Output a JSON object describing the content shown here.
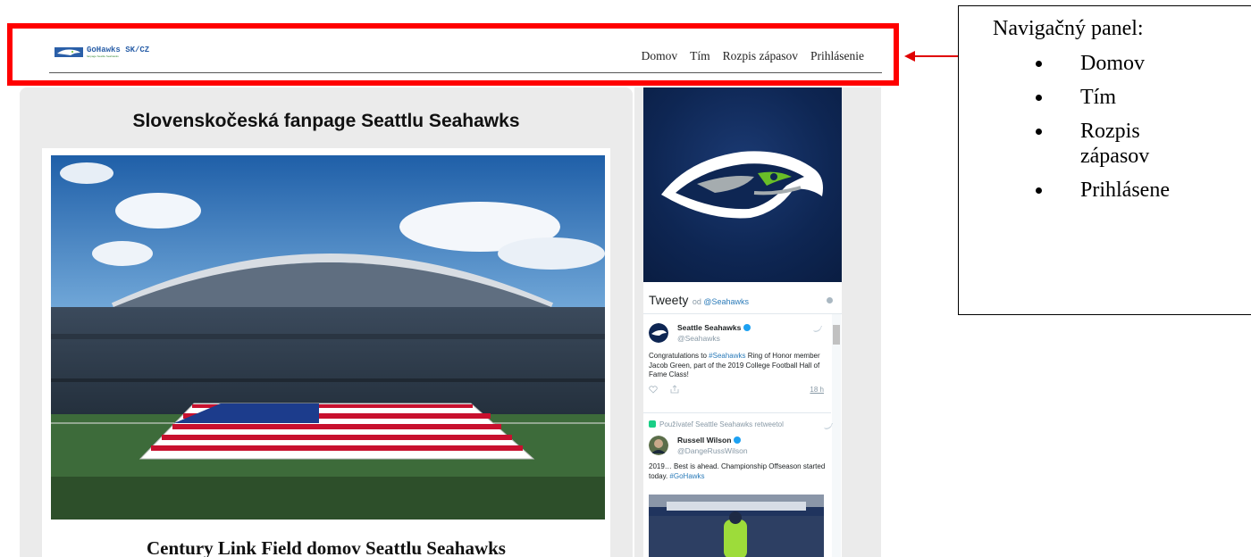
{
  "site": {
    "logo_text": "GoHawks SK/CZ",
    "logo_tagline": "fanpage Seattle Seahawks"
  },
  "nav": {
    "items": [
      {
        "label": "Domov"
      },
      {
        "label": "Tím"
      },
      {
        "label": "Rozpis zápasov"
      },
      {
        "label": "Prihlásenie"
      }
    ]
  },
  "annotation": {
    "title": "Navigačný panel:",
    "items": [
      "Domov",
      "Tím",
      "Rozpis zápasov",
      "Prihlásene"
    ]
  },
  "main": {
    "title": "Slovenskočeská fanpage Seattlu Seahawks",
    "caption": "Century Link Field domov Seattlu Seahawks"
  },
  "twitter": {
    "header_title": "Tweety",
    "header_by": "od",
    "header_handle": "@Seahawks",
    "tweet1": {
      "name": "Seattle Seahawks",
      "handle": "@Seahawks",
      "text_before": "Congratulations to ",
      "text_link": "#Seahawks",
      "text_after": " Ring of Honor member Jacob Green, part of the 2019 College Football Hall of Fame Class!",
      "time": "18 h"
    },
    "retweet_label": "Používateľ Seattle Seahawks retweetol",
    "tweet2": {
      "name": "Russell Wilson",
      "handle": "@DangeRussWilson",
      "text_before": "2019… Best is ahead. Championship Offseason started today. ",
      "text_link": "#GoHawks"
    }
  },
  "colors": {
    "highlight": "#ff0000",
    "arrow": "#e00000",
    "seahawks_navy": "#0e2653",
    "seahawks_green": "#69be28",
    "twitter_link": "#2b7bb9"
  }
}
